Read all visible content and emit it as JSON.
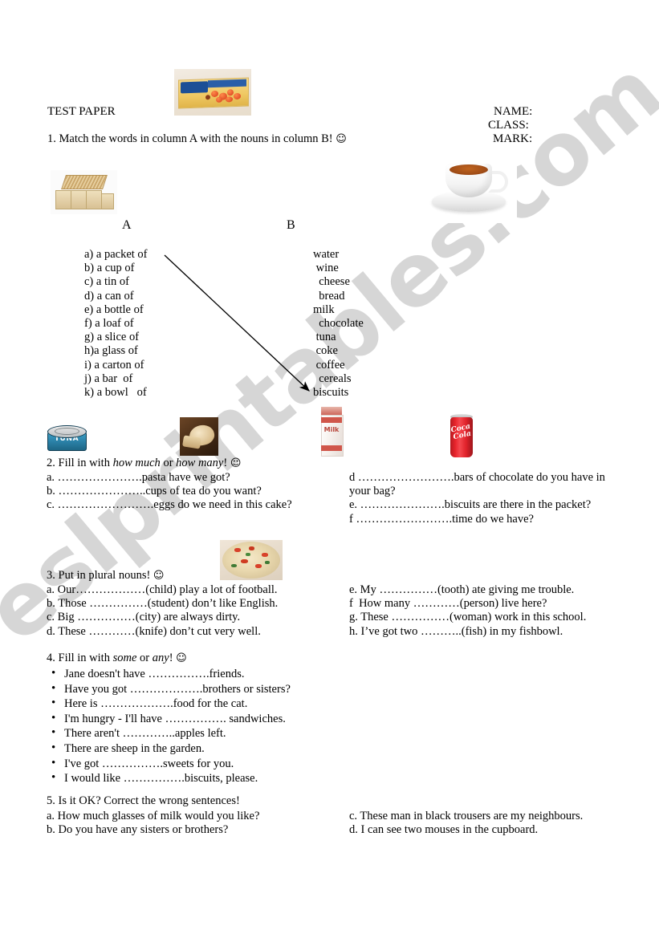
{
  "header": {
    "title": "TEST PAPER",
    "name_label": "NAME:",
    "class_label": "CLASS:",
    "mark_label": "MARK:"
  },
  "watermark": {
    "text": "eslprintables.com",
    "color": "#c9c9c9"
  },
  "exercise1": {
    "instruction": "1. Match the words in column A with the nouns in column B!",
    "smiley": "☺",
    "column_a_header": "A",
    "column_b_header": "B",
    "column_a": [
      "a) a packet of",
      "b) a cup of",
      "c) a tin of",
      "d) a can of",
      "e) a bottle of",
      "f) a loaf of",
      "g) a slice of",
      "h)a glass of",
      "i) a carton of",
      "j) a bar  of",
      "k) a bowl   of"
    ],
    "column_b": [
      "water",
      " wine",
      "  cheese",
      "  bread",
      "milk",
      "  chocolate",
      " tuna",
      " coke",
      " coffee",
      "  cereals",
      "biscuits"
    ],
    "drawn_match": {
      "from": "a) a packet of",
      "to": "biscuits"
    }
  },
  "exercise2": {
    "instruction_prefix": "2. Fill in with ",
    "instruction_italic1": "how much",
    "instruction_mid": " or ",
    "instruction_italic2": "how many",
    "instruction_suffix": "!",
    "smiley": "☺",
    "left_items": [
      "a. ………………….pasta have we got?",
      "b. …………………..cups of tea do you want?",
      "c. …………………….eggs do we need in this cake?"
    ],
    "right_items": [
      "d …………………….bars of chocolate do you have in",
      "your bag?",
      "e. ………………….biscuits are there in the packet?",
      "f …………………….time do we have?"
    ]
  },
  "exercise3": {
    "instruction": "3. Put in plural nouns!",
    "smiley": "☺",
    "left_items": [
      "a. Our………………(child) play a lot of football.",
      "b. Those ……………(student) don’t like English.",
      "c. Big ……………(city) are always dirty.",
      "d. These …………(knife) don’t cut very well."
    ],
    "right_items": [
      "e. My ……………(tooth) ate giving me trouble.",
      "f  How many …………(person) live here?",
      "g. These ……………(woman) work in this school.",
      "h. I’ve got two ………..(fish) in my fishbowl."
    ]
  },
  "exercise4": {
    "instruction_prefix": "4. Fill in with ",
    "instruction_italic1": "some",
    "instruction_mid": " or ",
    "instruction_italic2": "any",
    "instruction_suffix": "!",
    "smiley": "☺",
    "items": [
      "Jane doesn't have …………….friends.",
      "Have you got ……………….brothers or sisters?",
      "Here is ……………….food for the cat.",
      "I'm hungry - I'll have ……………. sandwiches.",
      "There aren't …………..apples left.",
      "There are  sheep in the garden.",
      "I've got …………….sweets for you.",
      "I would like …………….biscuits, please."
    ]
  },
  "exercise5": {
    "instruction": "5. Is it OK? Correct the wrong sentences!",
    "left_items": [
      "a. How much glasses of milk would you like?",
      "b. Do you have any sisters or brothers?"
    ],
    "right_items": [
      "c. These man in black trousers are my neighbours.",
      "d. I can see two mouses in the cupboard."
    ]
  },
  "images": {
    "biscuit_box": "biscuit-box-photo",
    "crackers": "crackers-stack-photo",
    "teacup": "teacup-of-tea-photo",
    "tuna_can": "tuna-can-photo",
    "bread": "bread-loaf-photo",
    "milk_carton": "milk-carton-photo",
    "coke_can": "coca-cola-can-photo",
    "pasta_bowl": "pasta-bowl-photo"
  }
}
